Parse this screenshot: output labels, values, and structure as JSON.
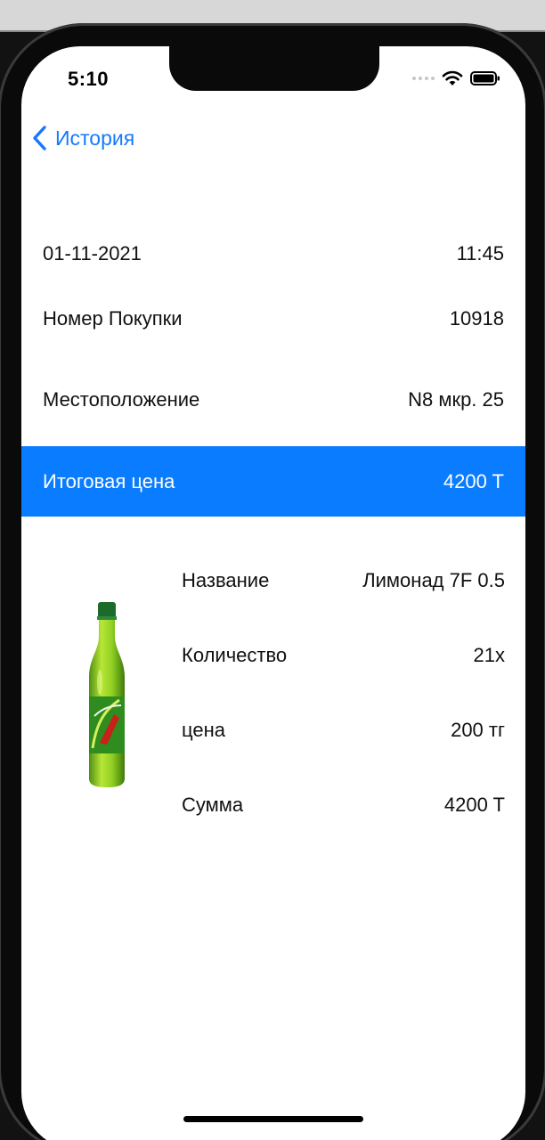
{
  "status_bar": {
    "time": "5:10",
    "icons": [
      "cellular-signal-icon",
      "wifi-icon",
      "battery-icon"
    ]
  },
  "nav": {
    "back_label": "История",
    "back_icon": "chevron-left-icon"
  },
  "purchase": {
    "date": "01-11-2021",
    "time": "11:45",
    "number_label": "Номер Покупки",
    "number_value": "10918",
    "location_label": "Местоположение",
    "location_value": "N8 мкр. 25",
    "total_label": "Итоговая цена",
    "total_value": "4200 T"
  },
  "product": {
    "image": "soda-bottle-image",
    "name_label": "Название",
    "name_value": "Лимонад 7F 0.5",
    "quantity_label": "Количество",
    "quantity_value": "21x",
    "price_label": "цена",
    "price_value": "200 тг",
    "sum_label": "Сумма",
    "sum_value": "4200 T"
  },
  "colors": {
    "accent": "#1678ff",
    "total_bar": "#0a7cff",
    "text": "#111111",
    "background": "#ffffff"
  }
}
